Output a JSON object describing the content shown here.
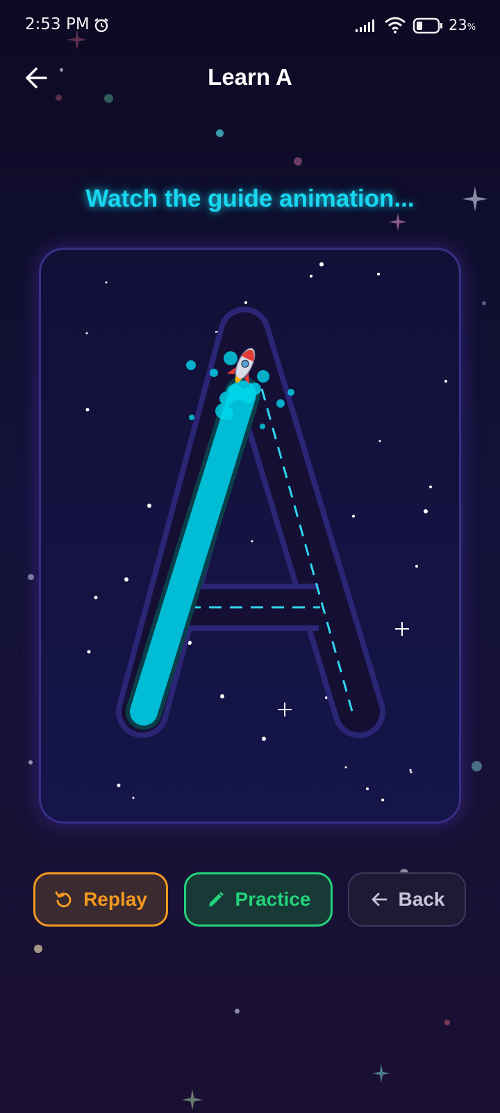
{
  "status_bar": {
    "time": "2:53 PM",
    "battery_value": "23",
    "battery_unit": "%",
    "icons": [
      "alarm-icon",
      "signal-icon",
      "wifi-icon",
      "battery-icon"
    ]
  },
  "header": {
    "title": "Learn A",
    "back_icon": "arrow-left-icon"
  },
  "guide": {
    "instruction": "Watch the guide animation..."
  },
  "canvas": {
    "letter": "A",
    "trace_progress": 0.33,
    "trace_color": "#00bcd4",
    "guide_dash_color": "#2fd6ef",
    "cursor_icon": "rocket-icon"
  },
  "actions": {
    "replay": {
      "label": "Replay",
      "icon": "replay-icon",
      "color": "#f59a1f"
    },
    "practice": {
      "label": "Practice",
      "icon": "pencil-icon",
      "color": "#23d27a"
    },
    "back": {
      "label": "Back",
      "icon": "arrow-left-icon",
      "color": "#c9c6d9"
    }
  },
  "colors": {
    "accent": "#19d7f0",
    "background": "#0c0a22",
    "card_border": "#3a2f86"
  }
}
